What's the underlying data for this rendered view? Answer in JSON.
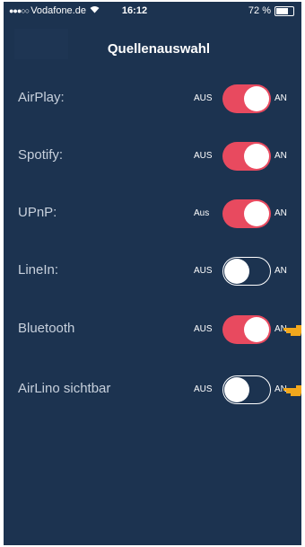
{
  "status_bar": {
    "signal": "●●●○○",
    "carrier": "Vodafone.de",
    "wifi_icon": "wifi-icon",
    "time": "16:12",
    "battery": "72 %",
    "battery_level": 0.72
  },
  "header": {
    "title": "Quellenauswahl"
  },
  "settings": [
    {
      "label": "AirPlay:",
      "off_label": "AUS",
      "on_label": "AN",
      "enabled": true
    },
    {
      "label": "Spotify:",
      "off_label": "AUS",
      "on_label": "AN",
      "enabled": true
    },
    {
      "label": "UPnP:",
      "off_label": "Aus",
      "on_label": "AN",
      "enabled": true
    },
    {
      "label": "LineIn:",
      "off_label": "AUS",
      "on_label": "AN",
      "enabled": false
    },
    {
      "label": "Bluetooth",
      "off_label": "AUS",
      "on_label": "AN",
      "enabled": true
    },
    {
      "label": "AirLino sichtbar",
      "off_label": "AUS",
      "on_label": "AN",
      "enabled": false
    }
  ],
  "colors": {
    "background": "#1c3350",
    "toggle_on": "#e84a5f",
    "pointer": "#f2a81d"
  },
  "annotations": {
    "pointer_icon": "pointing-hand-icon"
  }
}
